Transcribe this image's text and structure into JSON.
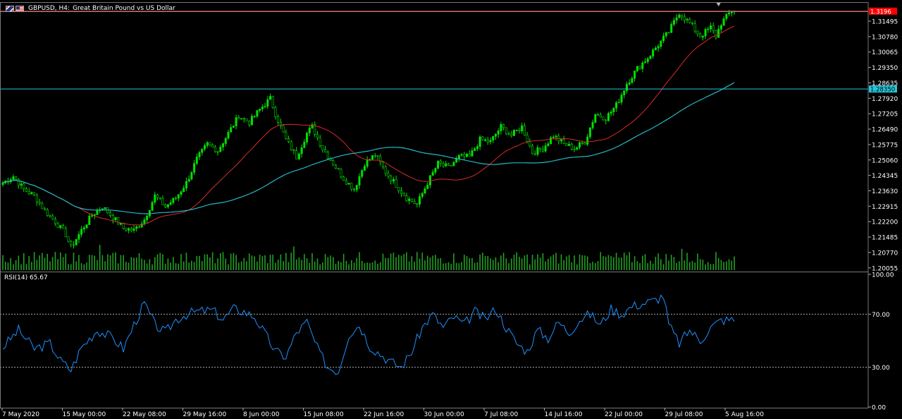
{
  "header": {
    "symbol": "GBPUSD, H4:",
    "description": "Great Britain Pound vs US Dollar"
  },
  "rsi_label": "RSI(14) 65.67",
  "colors": {
    "background": "#000000",
    "bull_candle": "#00e000",
    "volume": "#22a022",
    "ma_red": "#d92b2b",
    "ma_cyan": "#25b7c6",
    "rsi_line": "#1e90ff",
    "price_line": "#26c6da",
    "current_price_box": "#ff0000",
    "grid_text": "#ffffff"
  },
  "chart_data": [
    {
      "type": "candlestick",
      "title": "GBPUSD, H4: Great Britain Pound vs US Dollar",
      "ylim": [
        1.1995,
        1.3215
      ],
      "yticks": [
        "1.31495",
        "1.30780",
        "1.30065",
        "1.29350",
        "1.28635",
        "1.27920",
        "1.27205",
        "1.26490",
        "1.25775",
        "1.25060",
        "1.24345",
        "1.23630",
        "1.22915",
        "1.22200",
        "1.21485",
        "1.20770",
        "1.20055"
      ],
      "xticks": [
        "7 May 2020",
        "15 May 00:00",
        "22 May 08:00",
        "29 May 16:00",
        "8 Jun 00:00",
        "15 Jun 08:00",
        "22 Jun 16:00",
        "30 Jun 00:00",
        "7 Jul 08:00",
        "14 Jul 16:00",
        "22 Jul 00:00",
        "29 Jul 08:00",
        "5 Aug 16:00"
      ],
      "current_price": "1.3196",
      "horizontal_line": "1.28350",
      "close_anchors": [
        [
          0,
          1.24
        ],
        [
          4,
          1.243
        ],
        [
          8,
          1.237
        ],
        [
          12,
          1.234
        ],
        [
          16,
          1.227
        ],
        [
          20,
          1.222
        ],
        [
          24,
          1.216
        ],
        [
          26,
          1.21
        ],
        [
          30,
          1.218
        ],
        [
          34,
          1.225
        ],
        [
          38,
          1.229
        ],
        [
          42,
          1.224
        ],
        [
          46,
          1.219
        ],
        [
          50,
          1.218
        ],
        [
          54,
          1.223
        ],
        [
          58,
          1.234
        ],
        [
          62,
          1.229
        ],
        [
          66,
          1.233
        ],
        [
          70,
          1.24
        ],
        [
          74,
          1.251
        ],
        [
          78,
          1.258
        ],
        [
          82,
          1.255
        ],
        [
          86,
          1.263
        ],
        [
          90,
          1.271
        ],
        [
          94,
          1.268
        ],
        [
          98,
          1.274
        ],
        [
          102,
          1.279
        ],
        [
          104,
          1.272
        ],
        [
          108,
          1.26
        ],
        [
          112,
          1.252
        ],
        [
          116,
          1.263
        ],
        [
          118,
          1.266
        ],
        [
          122,
          1.256
        ],
        [
          126,
          1.249
        ],
        [
          130,
          1.242
        ],
        [
          134,
          1.237
        ],
        [
          138,
          1.249
        ],
        [
          142,
          1.253
        ],
        [
          146,
          1.245
        ],
        [
          150,
          1.239
        ],
        [
          154,
          1.233
        ],
        [
          158,
          1.23
        ],
        [
          162,
          1.24
        ],
        [
          166,
          1.249
        ],
        [
          170,
          1.247
        ],
        [
          174,
          1.252
        ],
        [
          178,
          1.252
        ],
        [
          182,
          1.26
        ],
        [
          186,
          1.259
        ],
        [
          190,
          1.266
        ],
        [
          194,
          1.262
        ],
        [
          198,
          1.266
        ],
        [
          202,
          1.254
        ],
        [
          206,
          1.256
        ],
        [
          210,
          1.262
        ],
        [
          214,
          1.258
        ],
        [
          218,
          1.256
        ],
        [
          222,
          1.259
        ],
        [
          226,
          1.272
        ],
        [
          230,
          1.27
        ],
        [
          234,
          1.276
        ],
        [
          238,
          1.286
        ],
        [
          242,
          1.293
        ],
        [
          246,
          1.298
        ],
        [
          250,
          1.304
        ],
        [
          254,
          1.31
        ],
        [
          258,
          1.319
        ],
        [
          262,
          1.314
        ],
        [
          266,
          1.308
        ],
        [
          270,
          1.312
        ],
        [
          272,
          1.308
        ],
        [
          274,
          1.314
        ],
        [
          278,
          1.32
        ]
      ]
    },
    {
      "type": "line",
      "title": "RSI(14) 65.67",
      "ylim": [
        0,
        100
      ],
      "yticks": [
        "100.00",
        "70.00",
        "30.00",
        "0.00"
      ],
      "levels": [
        70,
        30
      ],
      "anchors": [
        [
          0,
          45
        ],
        [
          6,
          58
        ],
        [
          12,
          44
        ],
        [
          18,
          48
        ],
        [
          22,
          35
        ],
        [
          26,
          28
        ],
        [
          30,
          45
        ],
        [
          36,
          58
        ],
        [
          42,
          52
        ],
        [
          46,
          44
        ],
        [
          50,
          62
        ],
        [
          54,
          78
        ],
        [
          58,
          62
        ],
        [
          62,
          56
        ],
        [
          66,
          66
        ],
        [
          70,
          70
        ],
        [
          74,
          72
        ],
        [
          80,
          73
        ],
        [
          84,
          66
        ],
        [
          88,
          74
        ],
        [
          92,
          72
        ],
        [
          96,
          68
        ],
        [
          100,
          55
        ],
        [
          104,
          42
        ],
        [
          108,
          38
        ],
        [
          112,
          56
        ],
        [
          116,
          64
        ],
        [
          120,
          44
        ],
        [
          124,
          30
        ],
        [
          128,
          27
        ],
        [
          132,
          55
        ],
        [
          136,
          62
        ],
        [
          140,
          46
        ],
        [
          144,
          40
        ],
        [
          148,
          34
        ],
        [
          152,
          30
        ],
        [
          156,
          42
        ],
        [
          160,
          60
        ],
        [
          164,
          70
        ],
        [
          168,
          60
        ],
        [
          172,
          68
        ],
        [
          176,
          62
        ],
        [
          180,
          72
        ],
        [
          184,
          66
        ],
        [
          188,
          74
        ],
        [
          192,
          60
        ],
        [
          196,
          48
        ],
        [
          200,
          42
        ],
        [
          204,
          58
        ],
        [
          208,
          52
        ],
        [
          212,
          64
        ],
        [
          216,
          56
        ],
        [
          220,
          66
        ],
        [
          224,
          70
        ],
        [
          228,
          62
        ],
        [
          232,
          74
        ],
        [
          236,
          70
        ],
        [
          240,
          76
        ],
        [
          244,
          78
        ],
        [
          248,
          80
        ],
        [
          252,
          84
        ],
        [
          254,
          62
        ],
        [
          258,
          48
        ],
        [
          262,
          58
        ],
        [
          266,
          50
        ],
        [
          270,
          60
        ],
        [
          274,
          65.67
        ]
      ]
    }
  ]
}
